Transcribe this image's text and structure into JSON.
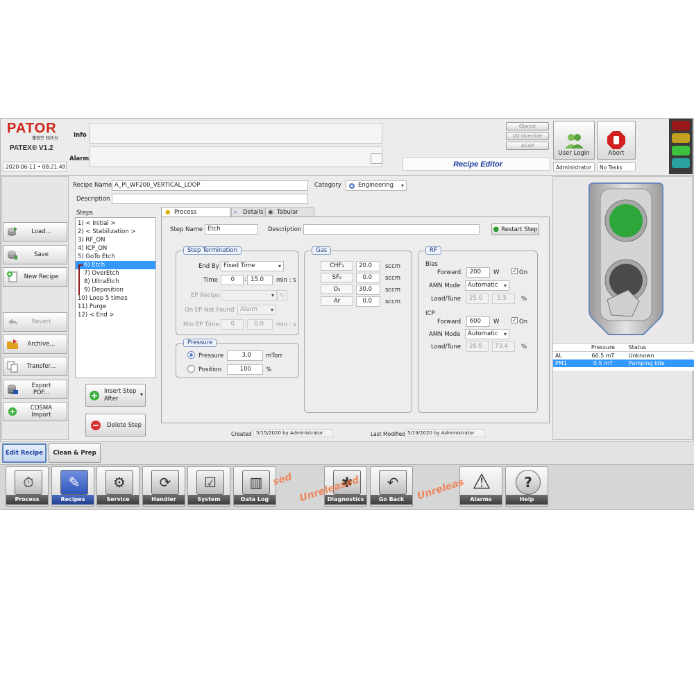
{
  "header": {
    "brand": "PATOR",
    "brand_cn": "僅真空 知托付",
    "version": "PATEX® V1.2",
    "datetime": "2020-06-11 • 08:21:49",
    "info_label": "Info",
    "alarm_label": "Alarm",
    "glance": "Glance",
    "io_override": "I/O Override",
    "acap": "ACAP",
    "screen_title": "Recipe Editor",
    "user_login": "User Login",
    "abort": "Abort",
    "user_name": "Administrator",
    "task_status": "No Tasks"
  },
  "left_panel": {
    "load": "Load...",
    "save": "Save",
    "new_recipe": "New Recipe",
    "revert": "Revert",
    "archive": "Archive...",
    "transfer": "Transfer...",
    "export_pdf": "Export PDF...",
    "cosma_import": "COSMA Import"
  },
  "recipe": {
    "name_label": "Recipe Name",
    "name_value": "A_PI_WF200_VERTICAL_LOOP",
    "category_label": "Category",
    "category_value": "Engineering",
    "description_label": "Description",
    "description_value": "",
    "steps_label": "Steps",
    "steps": [
      "1) < Initial >",
      "2) < Stabilization >",
      "3) RF_ON",
      "4) ICP_ON",
      "5) GoTo Etch",
      "6) Etch",
      "7) OverEtch",
      "8) UltraEtch",
      "9) Deposition",
      "10) Loop 5 times",
      "11) Purge",
      "12) < End >"
    ],
    "insert_step": "Insert Step",
    "insert_after": "After",
    "delete_step": "Delete Step"
  },
  "tabs": {
    "process_parameters": "Process Parameters",
    "details": "Details",
    "tabular_view": "Tabular View"
  },
  "step": {
    "name_label": "Step Name",
    "name_value": "Etch",
    "description_label": "Description",
    "description_value": "",
    "restart_step": "Restart Step"
  },
  "termination": {
    "title": "Step Termination",
    "end_by_label": "End By",
    "end_by_value": "Fixed Time",
    "time_label": "Time",
    "time_min": "0",
    "time_sec": "15.0",
    "time_unit": "min : s",
    "ep_recipe_label": "EP Recipe",
    "on_ep_label": "On EP Not Found",
    "on_ep_value": "Alarm",
    "min_ep_label": "Min EP Time",
    "min_ep_min": "0",
    "min_ep_sec": "0.0",
    "min_ep_unit": "min : s"
  },
  "pressure": {
    "title": "Pressure",
    "pressure_label": "Pressure",
    "pressure_value": "3.0",
    "pressure_unit": "mTorr",
    "position_label": "Position",
    "position_value": "100",
    "position_unit": "%"
  },
  "gas": {
    "title": "Gas",
    "unit": "sccm",
    "rows": [
      {
        "name": "CHF₃",
        "value": "20.0"
      },
      {
        "name": "SF₆",
        "value": "0.0"
      },
      {
        "name": "O₂",
        "value": "30.0"
      },
      {
        "name": "Ar",
        "value": "0.0"
      }
    ]
  },
  "rf": {
    "title": "RF",
    "bias_label": "Bias",
    "bias_forward_label": "Forward",
    "bias_forward_value": "200",
    "bias_unit": "W",
    "bias_on": "On",
    "bias_amn_label": "AMN Mode",
    "bias_amn_value": "Automatic",
    "bias_load_label": "Load/Tune",
    "bias_load": "25.0",
    "bias_tune": "5.5",
    "icp_label": "ICP",
    "icp_forward_label": "Forward",
    "icp_forward_value": "600",
    "icp_unit": "W",
    "icp_on": "On",
    "icp_amn_label": "AMN Mode",
    "icp_amn_value": "Automatic",
    "icp_load_label": "Load/Tune",
    "icp_load": "26.6",
    "icp_tune": "73.4",
    "pct": "%"
  },
  "footer_info": {
    "created_label": "Created",
    "created_value": "5/15/2020 by Administrator",
    "modified_label": "Last Modified",
    "modified_value": "5/19/2020 by Administrator"
  },
  "status_table": {
    "headers": [
      "",
      "Pressure",
      "Status"
    ],
    "rows": [
      [
        "AL",
        "66.5 mT",
        "Unknown"
      ],
      [
        "PM1",
        "0.5 mT",
        "Pumping Idle"
      ]
    ]
  },
  "subtabs": {
    "edit_recipe": "Edit Recipe",
    "clean_prep": "Clean & Prep"
  },
  "nav": {
    "process": "Process",
    "recipes": "Recipes",
    "service": "Service",
    "handler": "Handler",
    "system": "System",
    "data_log": "Data Log",
    "diagnostics": "Diagnostics",
    "go_back": "Go Back",
    "alarms": "Alarms",
    "help": "Help"
  },
  "watermarks": {
    "w1": "sed",
    "w2": "Unreleased",
    "w3": "Unreleas"
  },
  "colors": {
    "accent_blue": "#1a3fa0",
    "selection": "#3399ff",
    "led_green": "#1f9b2b"
  }
}
